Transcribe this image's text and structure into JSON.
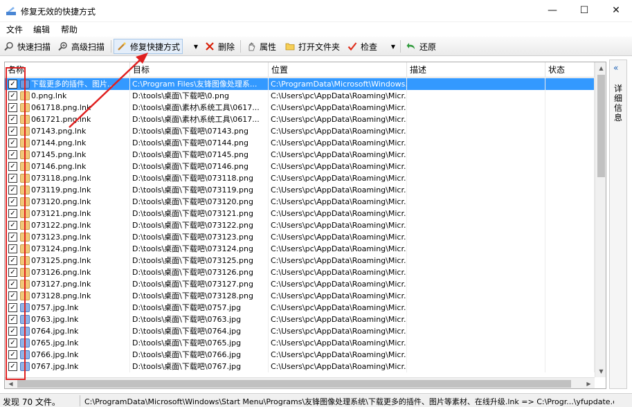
{
  "window": {
    "title": "修复无效的快捷方式",
    "controls": {
      "minimize": "—",
      "maximize": "☐",
      "close": "✕"
    }
  },
  "menu": [
    "文件",
    "编辑",
    "帮助"
  ],
  "toolbar": {
    "quick_scan": "快速扫描",
    "advanced_scan": "高级扫描",
    "fix_shortcut": "修复快捷方式",
    "delete": "删除",
    "properties": "属性",
    "open_folder": "打开文件夹",
    "check": "检查",
    "restore": "还原",
    "colors": {
      "delete_icon": "#d81e06",
      "check_icon": "#e0301e",
      "restore_icon": "#2e9a3a"
    }
  },
  "table": {
    "columns": [
      "名称",
      "目标",
      "位置",
      "描述",
      "状态"
    ],
    "rows": [
      {
        "checked": true,
        "type": "exe",
        "name": "下载更多的插件、图片...",
        "target": "C:\\Program Files\\友锋图像处理系...",
        "location": "C:\\ProgramData\\Microsoft\\Windows...",
        "desc": "",
        "status": "",
        "selected": true
      },
      {
        "checked": true,
        "type": "png",
        "name": "0.png.lnk",
        "target": "D:\\tools\\桌面\\下载吧\\0.png",
        "location": "C:\\Users\\pc\\AppData\\Roaming\\Micr...",
        "desc": "",
        "status": ""
      },
      {
        "checked": true,
        "type": "png",
        "name": "061718.png.lnk",
        "target": "D:\\tools\\桌面\\素材\\系统工具\\0617...",
        "location": "C:\\Users\\pc\\AppData\\Roaming\\Micr...",
        "desc": "",
        "status": ""
      },
      {
        "checked": true,
        "type": "png",
        "name": "061721.png.lnk",
        "target": "D:\\tools\\桌面\\素材\\系统工具\\0617...",
        "location": "C:\\Users\\pc\\AppData\\Roaming\\Micr...",
        "desc": "",
        "status": ""
      },
      {
        "checked": true,
        "type": "png",
        "name": "07143.png.lnk",
        "target": "D:\\tools\\桌面\\下载吧\\07143.png",
        "location": "C:\\Users\\pc\\AppData\\Roaming\\Micr...",
        "desc": "",
        "status": ""
      },
      {
        "checked": true,
        "type": "png",
        "name": "07144.png.lnk",
        "target": "D:\\tools\\桌面\\下载吧\\07144.png",
        "location": "C:\\Users\\pc\\AppData\\Roaming\\Micr...",
        "desc": "",
        "status": ""
      },
      {
        "checked": true,
        "type": "png",
        "name": "07145.png.lnk",
        "target": "D:\\tools\\桌面\\下载吧\\07145.png",
        "location": "C:\\Users\\pc\\AppData\\Roaming\\Micr...",
        "desc": "",
        "status": ""
      },
      {
        "checked": true,
        "type": "png",
        "name": "07146.png.lnk",
        "target": "D:\\tools\\桌面\\下载吧\\07146.png",
        "location": "C:\\Users\\pc\\AppData\\Roaming\\Micr...",
        "desc": "",
        "status": ""
      },
      {
        "checked": true,
        "type": "png",
        "name": "073118.png.lnk",
        "target": "D:\\tools\\桌面\\下载吧\\073118.png",
        "location": "C:\\Users\\pc\\AppData\\Roaming\\Micr...",
        "desc": "",
        "status": ""
      },
      {
        "checked": true,
        "type": "png",
        "name": "073119.png.lnk",
        "target": "D:\\tools\\桌面\\下载吧\\073119.png",
        "location": "C:\\Users\\pc\\AppData\\Roaming\\Micr...",
        "desc": "",
        "status": ""
      },
      {
        "checked": true,
        "type": "png",
        "name": "073120.png.lnk",
        "target": "D:\\tools\\桌面\\下载吧\\073120.png",
        "location": "C:\\Users\\pc\\AppData\\Roaming\\Micr...",
        "desc": "",
        "status": ""
      },
      {
        "checked": true,
        "type": "png",
        "name": "073121.png.lnk",
        "target": "D:\\tools\\桌面\\下载吧\\073121.png",
        "location": "C:\\Users\\pc\\AppData\\Roaming\\Micr...",
        "desc": "",
        "status": ""
      },
      {
        "checked": true,
        "type": "png",
        "name": "073122.png.lnk",
        "target": "D:\\tools\\桌面\\下载吧\\073122.png",
        "location": "C:\\Users\\pc\\AppData\\Roaming\\Micr...",
        "desc": "",
        "status": ""
      },
      {
        "checked": true,
        "type": "png",
        "name": "073123.png.lnk",
        "target": "D:\\tools\\桌面\\下载吧\\073123.png",
        "location": "C:\\Users\\pc\\AppData\\Roaming\\Micr...",
        "desc": "",
        "status": ""
      },
      {
        "checked": true,
        "type": "png",
        "name": "073124.png.lnk",
        "target": "D:\\tools\\桌面\\下载吧\\073124.png",
        "location": "C:\\Users\\pc\\AppData\\Roaming\\Micr...",
        "desc": "",
        "status": ""
      },
      {
        "checked": true,
        "type": "png",
        "name": "073125.png.lnk",
        "target": "D:\\tools\\桌面\\下载吧\\073125.png",
        "location": "C:\\Users\\pc\\AppData\\Roaming\\Micr...",
        "desc": "",
        "status": ""
      },
      {
        "checked": true,
        "type": "png",
        "name": "073126.png.lnk",
        "target": "D:\\tools\\桌面\\下载吧\\073126.png",
        "location": "C:\\Users\\pc\\AppData\\Roaming\\Micr...",
        "desc": "",
        "status": ""
      },
      {
        "checked": true,
        "type": "png",
        "name": "073127.png.lnk",
        "target": "D:\\tools\\桌面\\下载吧\\073127.png",
        "location": "C:\\Users\\pc\\AppData\\Roaming\\Micr...",
        "desc": "",
        "status": ""
      },
      {
        "checked": true,
        "type": "png",
        "name": "073128.png.lnk",
        "target": "D:\\tools\\桌面\\下载吧\\073128.png",
        "location": "C:\\Users\\pc\\AppData\\Roaming\\Micr...",
        "desc": "",
        "status": ""
      },
      {
        "checked": true,
        "type": "jpg",
        "name": "0757.jpg.lnk",
        "target": "D:\\tools\\桌面\\下载吧\\0757.jpg",
        "location": "C:\\Users\\pc\\AppData\\Roaming\\Micr...",
        "desc": "",
        "status": ""
      },
      {
        "checked": true,
        "type": "jpg",
        "name": "0763.jpg.lnk",
        "target": "D:\\tools\\桌面\\下载吧\\0763.jpg",
        "location": "C:\\Users\\pc\\AppData\\Roaming\\Micr...",
        "desc": "",
        "status": ""
      },
      {
        "checked": true,
        "type": "jpg",
        "name": "0764.jpg.lnk",
        "target": "D:\\tools\\桌面\\下载吧\\0764.jpg",
        "location": "C:\\Users\\pc\\AppData\\Roaming\\Micr...",
        "desc": "",
        "status": ""
      },
      {
        "checked": true,
        "type": "jpg",
        "name": "0765.jpg.lnk",
        "target": "D:\\tools\\桌面\\下载吧\\0765.jpg",
        "location": "C:\\Users\\pc\\AppData\\Roaming\\Micr...",
        "desc": "",
        "status": ""
      },
      {
        "checked": true,
        "type": "jpg",
        "name": "0766.jpg.lnk",
        "target": "D:\\tools\\桌面\\下载吧\\0766.jpg",
        "location": "C:\\Users\\pc\\AppData\\Roaming\\Micr...",
        "desc": "",
        "status": ""
      },
      {
        "checked": true,
        "type": "jpg",
        "name": "0767.jpg.lnk",
        "target": "D:\\tools\\桌面\\下载吧\\0767.jpg",
        "location": "C:\\Users\\pc\\AppData\\Roaming\\Micr...",
        "desc": "",
        "status": ""
      }
    ]
  },
  "side_panel": {
    "collapse_glyph": "«",
    "label": "详细信息"
  },
  "status_bar": {
    "count_text": "发现 70 文件。",
    "path_text": "C:\\ProgramData\\Microsoft\\Windows\\Start Menu\\Programs\\友锋图像处理系统\\下载更多的插件、图片等素材、在线升级.lnk => C:\\Progr...\\yfupdate.exe"
  },
  "colors": {
    "selection": "#3399ff",
    "annotation": "#e02020"
  }
}
